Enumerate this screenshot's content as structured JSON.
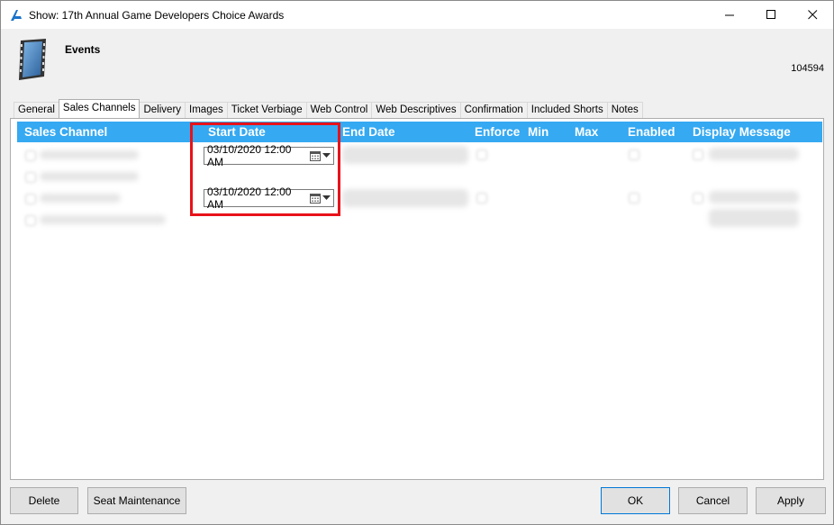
{
  "window": {
    "title": "Show: 17th Annual Game Developers Choice Awards",
    "controls": {
      "minimize": "—",
      "maximize": "☐",
      "close": "✕"
    }
  },
  "header": {
    "title": "Events",
    "record_id": "104594",
    "icon": "film-strip-icon"
  },
  "tabs": [
    {
      "label": "General"
    },
    {
      "label": "Sales Channels",
      "active": true
    },
    {
      "label": "Delivery"
    },
    {
      "label": "Images"
    },
    {
      "label": "Ticket Verbiage"
    },
    {
      "label": "Web Control"
    },
    {
      "label": "Web Descriptives"
    },
    {
      "label": "Confirmation"
    },
    {
      "label": "Included Shorts"
    },
    {
      "label": "Notes"
    }
  ],
  "grid": {
    "header_color": "#35a9f2",
    "columns": {
      "sales_channel": "Sales Channel",
      "start_date": "Start Date",
      "end_date": "End Date",
      "enforce": "Enforce",
      "min": "Min",
      "max": "Max",
      "enabled": "Enabled",
      "display_message": "Display Message"
    },
    "rows": [
      {
        "start_date": "03/10/2020 12:00 AM"
      },
      {
        "start_date": "03/10/2020 12:00 AM"
      }
    ]
  },
  "highlight_color": "#e8121a",
  "footer": {
    "delete": "Delete",
    "seat_maintenance": "Seat Maintenance",
    "ok": "OK",
    "cancel": "Cancel",
    "apply": "Apply"
  }
}
